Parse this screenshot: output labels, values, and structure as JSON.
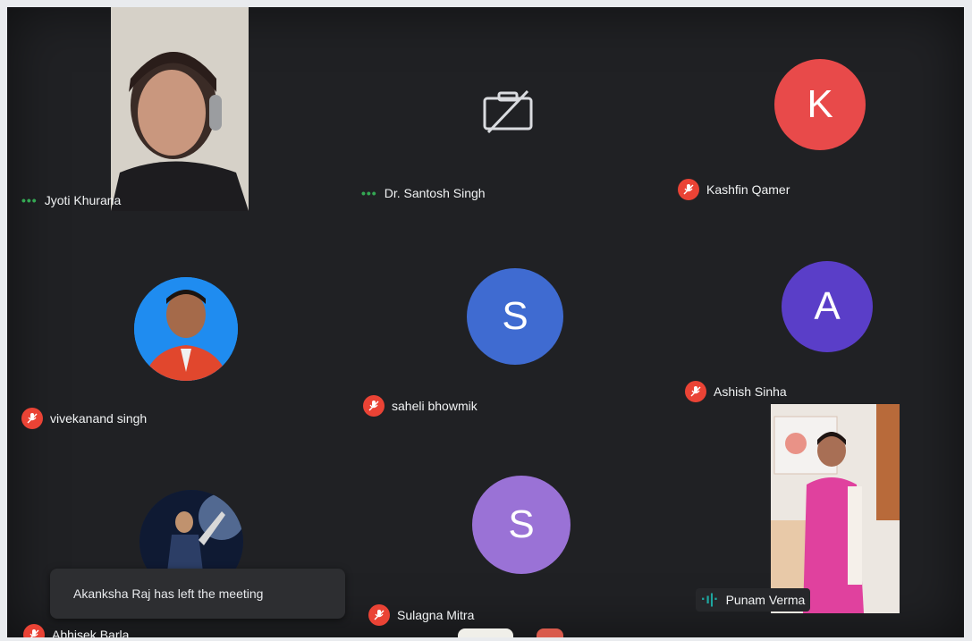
{
  "participants": [
    {
      "name": "Jyoti Khurana",
      "status": "speaking-dots"
    },
    {
      "name": "Dr. Santosh Singh",
      "status": "speaking-dots",
      "camera": "camera-off-icon"
    },
    {
      "name": "Kashfin Qamer",
      "status": "muted",
      "initial": "K",
      "color": "#e84a4a"
    },
    {
      "name": "vivekanand singh",
      "status": "muted"
    },
    {
      "name": "saheli bhowmik",
      "status": "muted",
      "initial": "S",
      "color": "#3f6bd1"
    },
    {
      "name": "Ashish Sinha",
      "status": "muted",
      "initial": "A",
      "color": "#5a3ec8"
    },
    {
      "name": "Abhisek Barla",
      "status": "muted"
    },
    {
      "name": "Sulagna Mitra",
      "status": "muted",
      "initial": "S",
      "color": "#9a72d6"
    },
    {
      "name": "Punam Verma",
      "status": "speaking"
    }
  ],
  "toast": {
    "message": "Akanksha Raj has left the meeting"
  },
  "colors": {
    "muted": "#ea4335",
    "speaking": "#34a853",
    "tile_bg": "#202124"
  }
}
